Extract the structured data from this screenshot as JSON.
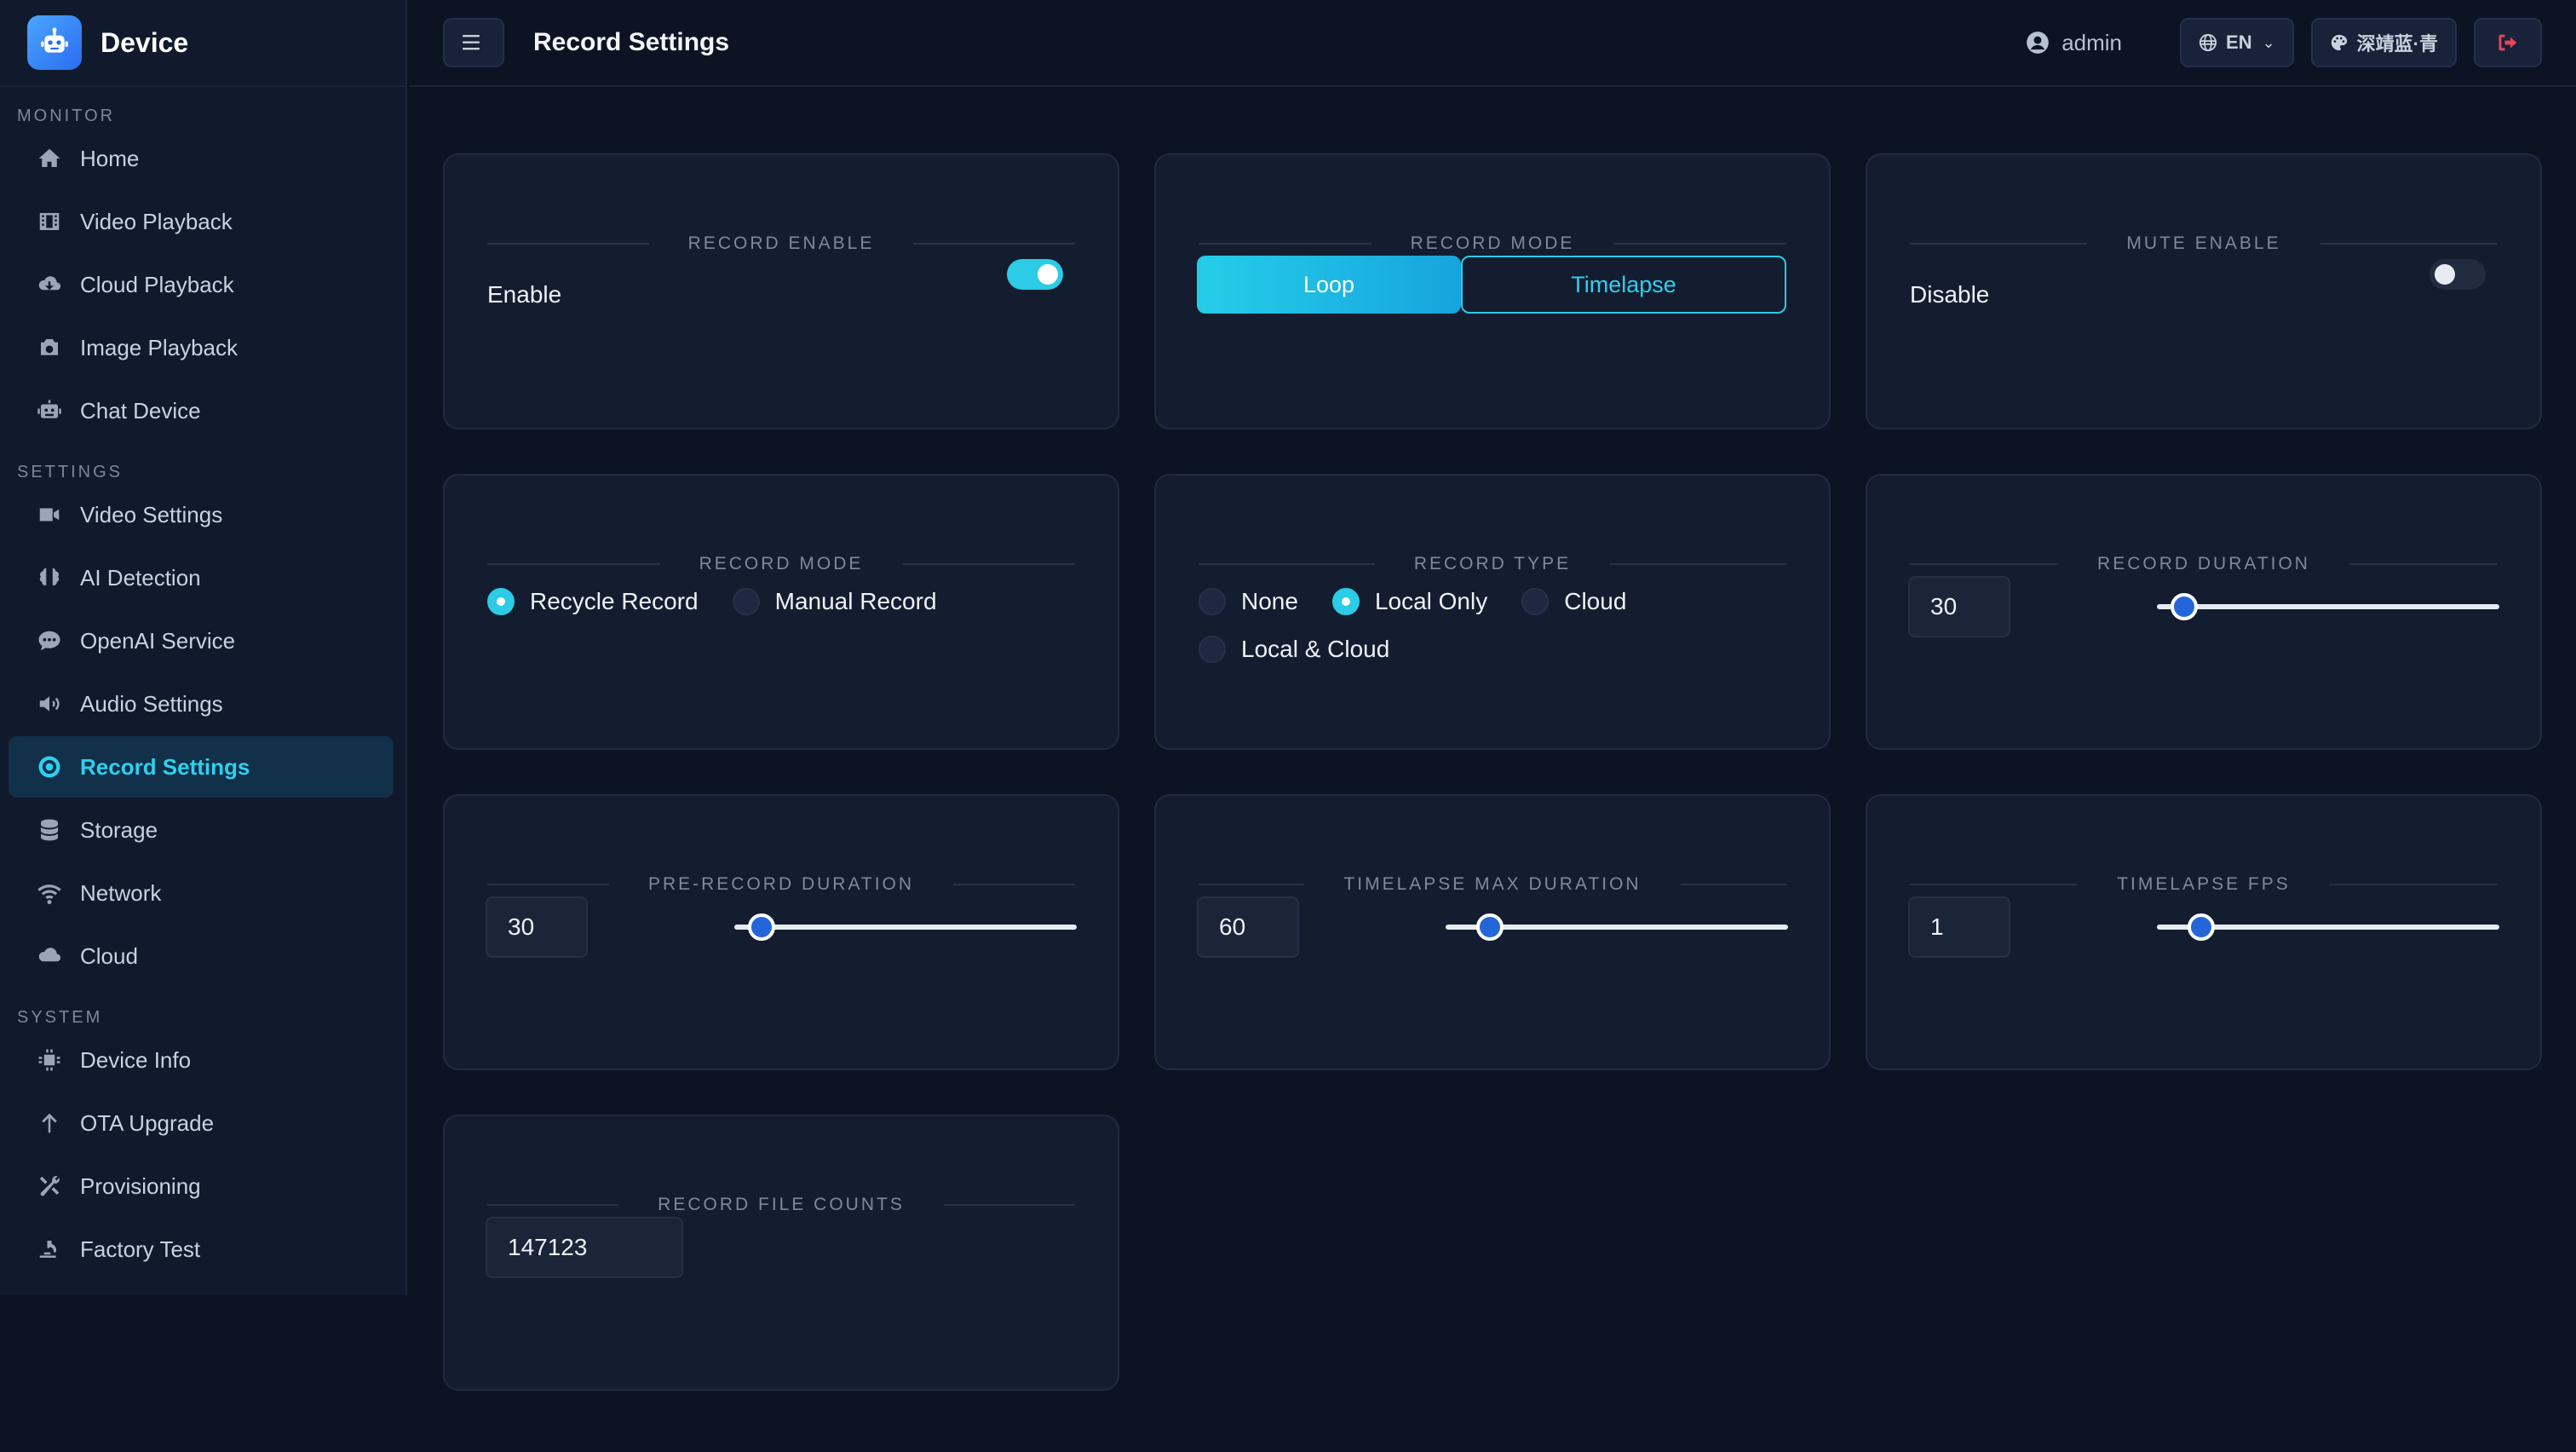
{
  "brand": {
    "name": "Device"
  },
  "sidebar": {
    "sections": [
      {
        "title": "MONITOR",
        "items": [
          {
            "label": "Home",
            "icon": "home-icon"
          },
          {
            "label": "Video Playback",
            "icon": "film-icon"
          },
          {
            "label": "Cloud Playback",
            "icon": "cloud-download-icon"
          },
          {
            "label": "Image Playback",
            "icon": "camera-icon"
          },
          {
            "label": "Chat Device",
            "icon": "robot-icon"
          }
        ]
      },
      {
        "title": "SETTINGS",
        "items": [
          {
            "label": "Video Settings",
            "icon": "video-camera-icon"
          },
          {
            "label": "AI Detection",
            "icon": "brain-icon"
          },
          {
            "label": "OpenAI Service",
            "icon": "chat-icon"
          },
          {
            "label": "Audio Settings",
            "icon": "speaker-icon"
          },
          {
            "label": "Record Settings",
            "icon": "record-icon",
            "active": true
          },
          {
            "label": "Storage",
            "icon": "database-icon"
          },
          {
            "label": "Network",
            "icon": "wifi-icon"
          },
          {
            "label": "Cloud",
            "icon": "cloud-icon"
          }
        ]
      },
      {
        "title": "SYSTEM",
        "items": [
          {
            "label": "Device Info",
            "icon": "chip-icon"
          },
          {
            "label": "OTA Upgrade",
            "icon": "arrow-up-icon"
          },
          {
            "label": "Provisioning",
            "icon": "tools-icon"
          },
          {
            "label": "Factory Test",
            "icon": "microscope-icon"
          }
        ]
      }
    ]
  },
  "header": {
    "title": "Record Settings",
    "user": "admin",
    "language": "EN",
    "theme": "深靖蓝·青"
  },
  "cards": {
    "record_enable": {
      "title": "RECORD ENABLE",
      "label": "Enable",
      "on": true
    },
    "record_mode_seg": {
      "title": "RECORD MODE",
      "options": [
        "Loop",
        "Timelapse"
      ],
      "selected": "Loop"
    },
    "mute_enable": {
      "title": "MUTE ENABLE",
      "label": "Disable",
      "on": false
    },
    "record_mode_radio": {
      "title": "RECORD MODE",
      "options": [
        "Recycle Record",
        "Manual Record"
      ],
      "selected": "Recycle Record"
    },
    "record_type": {
      "title": "RECORD TYPE",
      "options": [
        "None",
        "Local Only",
        "Cloud",
        "Local & Cloud"
      ],
      "selected": "Local Only"
    },
    "record_duration": {
      "title": "RECORD DURATION",
      "value": "30",
      "slider_fraction": 0.08
    },
    "pre_record_duration": {
      "title": "PRE-RECORD DURATION",
      "value": "30",
      "slider_fraction": 0.08
    },
    "timelapse_max_duration": {
      "title": "TIMELAPSE MAX DURATION",
      "value": "60",
      "slider_fraction": 0.13
    },
    "timelapse_fps": {
      "title": "TIMELAPSE FPS",
      "value": "1",
      "slider_fraction": 0.13
    },
    "record_file_counts": {
      "title": "RECORD FILE COUNTS",
      "value": "147123"
    }
  },
  "colors": {
    "accent": "#2ccbe6",
    "background": "#0c1424",
    "card": "#141d30",
    "slider_thumb": "#2466d9",
    "logout": "#e8445a"
  }
}
